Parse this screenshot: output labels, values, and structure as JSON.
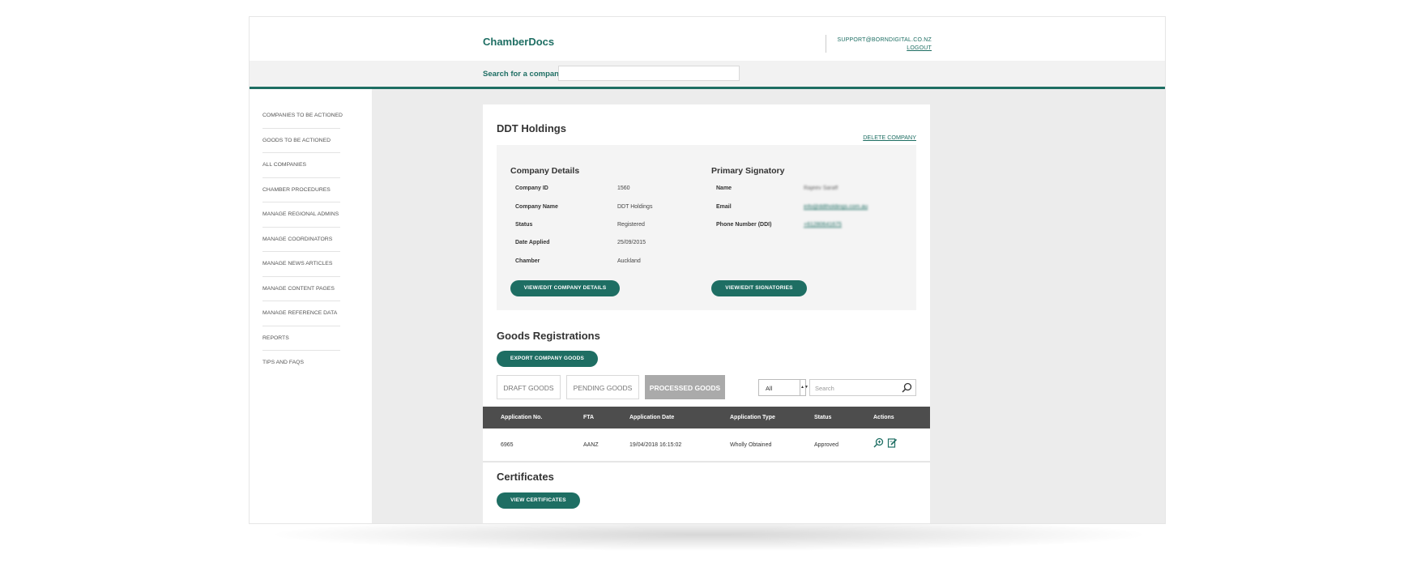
{
  "app": {
    "brand": "ChamberDocs"
  },
  "header": {
    "support_email": "SUPPORT@BORNDIGITAL.CO.NZ",
    "logout": "LOGOUT"
  },
  "search": {
    "label": "Search for a company",
    "value": ""
  },
  "sidebar": {
    "items": [
      {
        "label": "COMPANIES TO BE ACTIONED"
      },
      {
        "label": "GOODS TO BE ACTIONED"
      },
      {
        "label": "ALL COMPANIES"
      },
      {
        "label": "CHAMBER PROCEDURES"
      },
      {
        "label": "MANAGE REGIONAL ADMINS"
      },
      {
        "label": "MANAGE COORDINATORS"
      },
      {
        "label": "MANAGE NEWS ARTICLES"
      },
      {
        "label": "MANAGE CONTENT PAGES"
      },
      {
        "label": "MANAGE REFERENCE DATA"
      },
      {
        "label": "REPORTS"
      },
      {
        "label": "TIPS AND FAQS"
      }
    ]
  },
  "company": {
    "name": "DDT Holdings",
    "delete_label": "DELETE COMPANY",
    "details_heading": "Company Details",
    "details": [
      {
        "label": "Company ID",
        "value": "1560"
      },
      {
        "label": "Company Name",
        "value": "DDT Holdings"
      },
      {
        "label": "Status",
        "value": "Registered"
      },
      {
        "label": "Date Applied",
        "value": "25/09/2015"
      },
      {
        "label": "Chamber",
        "value": "Auckland"
      }
    ],
    "edit_details_button": "VIEW/EDIT COMPANY DETAILS",
    "signatory_heading": "Primary Signatory",
    "signatory": [
      {
        "label": "Name",
        "value": "Rajeev Saraff"
      },
      {
        "label": "Email",
        "value": "info@ddtholdings.com.au"
      },
      {
        "label": "Phone Number (DDI)",
        "value": "+61280641675"
      }
    ],
    "edit_signatories_button": "VIEW/EDIT SIGNATORIES"
  },
  "goods": {
    "heading": "Goods Registrations",
    "export_button": "EXPORT COMPANY GOODS",
    "tabs": [
      {
        "label": "DRAFT GOODS",
        "active": false
      },
      {
        "label": "PENDING GOODS",
        "active": false
      },
      {
        "label": "PROCESSED GOODS",
        "active": true
      }
    ],
    "filter": {
      "selected": "All"
    },
    "search_placeholder": "Search",
    "columns": [
      "Application No.",
      "FTA",
      "Application Date",
      "Application Type",
      "Status",
      "Actions"
    ],
    "rows": [
      {
        "app_no": "6965",
        "fta": "AANZ",
        "date": "19/04/2018 16:15:02",
        "type": "Wholly Obtained",
        "status": "Approved",
        "actions": [
          "view-icon",
          "edit-icon"
        ]
      }
    ]
  },
  "certificates": {
    "heading": "Certificates",
    "view_button": "VIEW CERTIFICATES"
  },
  "colors": {
    "accent": "#1e6e63",
    "table_header": "#4d4d4d",
    "content_bg": "#ececec",
    "panel_gray": "#f4f4f4"
  }
}
